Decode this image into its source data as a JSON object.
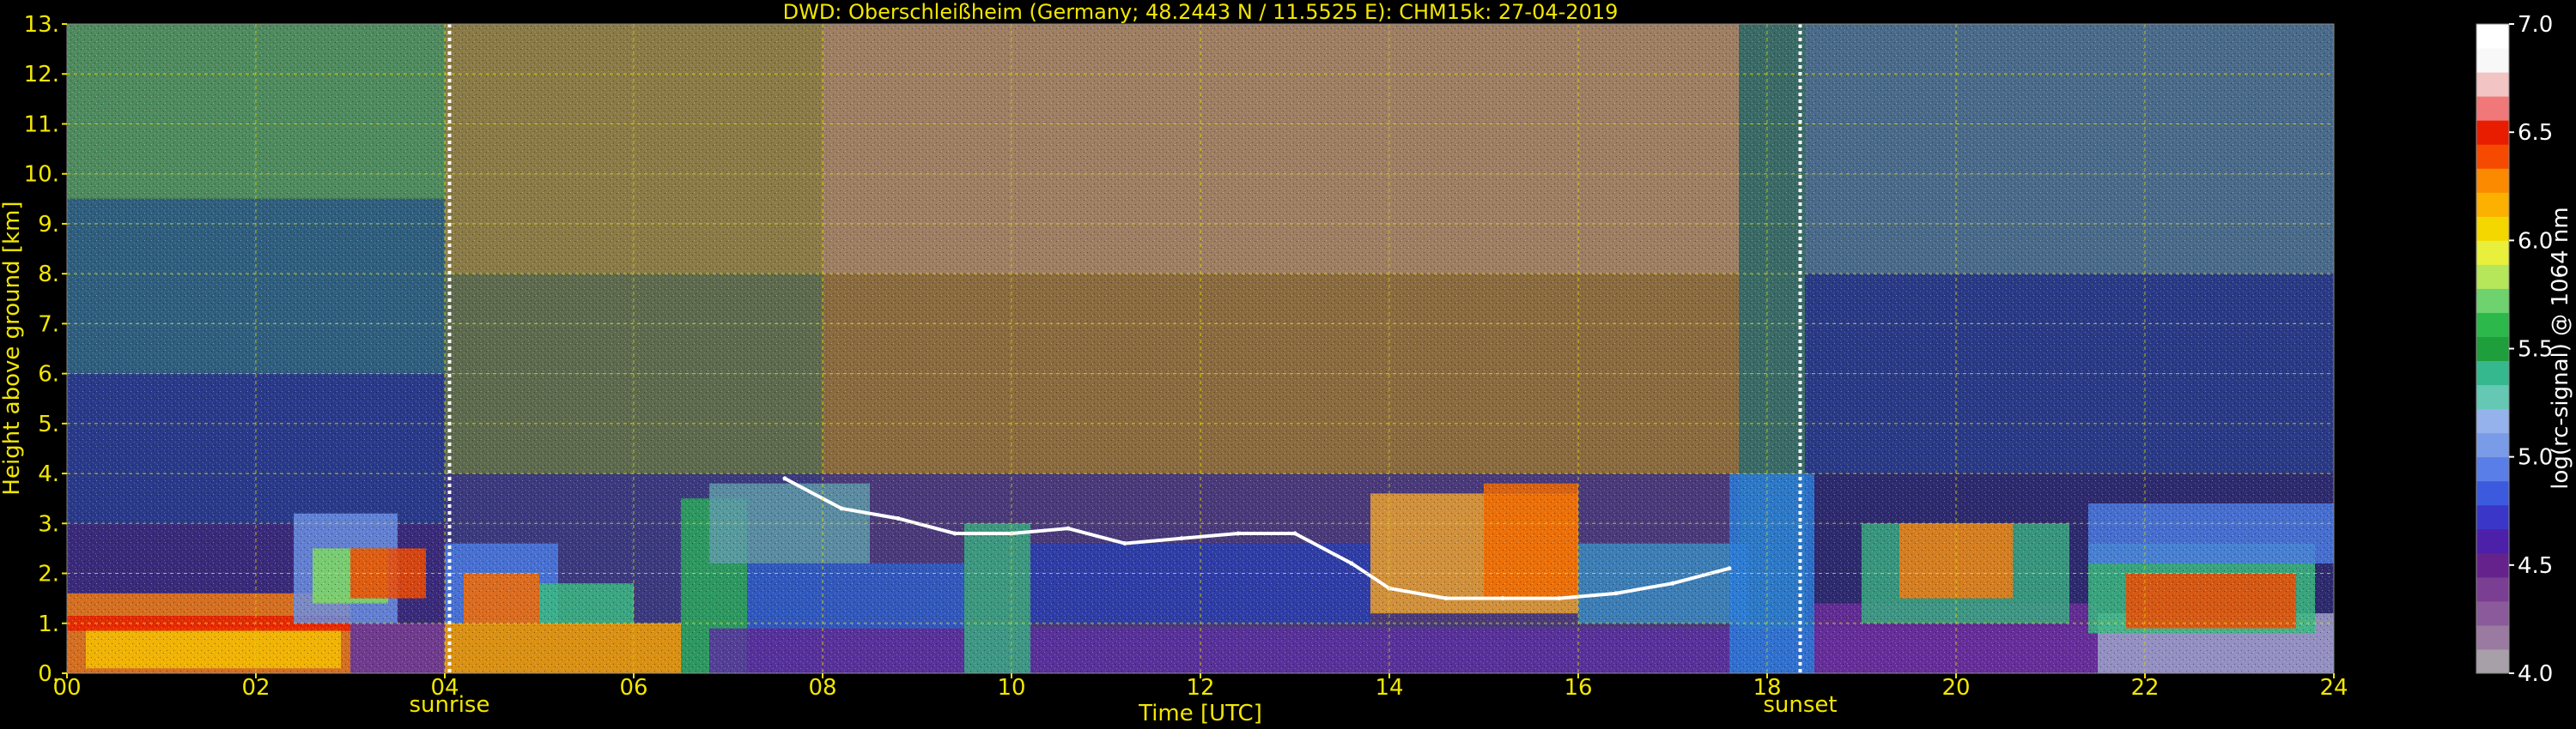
{
  "chart_data": {
    "type": "heatmap",
    "title": "DWD: Oberschleißheim (Germany; 48.2443 N / 11.5525 E):    CHM15k: 27-04-2019",
    "xlabel": "Time [UTC]",
    "ylabel": "Height above ground [km]",
    "colorbar_label": "log(rc-signal) @ 1064 nm",
    "xlim": [
      0,
      24
    ],
    "ylim": [
      0,
      13
    ],
    "color_range": [
      4.0,
      7.0
    ],
    "x_tick_labels": [
      "00",
      "02",
      "04",
      "06",
      "08",
      "10",
      "12",
      "14",
      "16",
      "18",
      "20",
      "22",
      "24"
    ],
    "y_tick_labels": [
      "0.",
      "1.",
      "2.",
      "3.",
      "4.",
      "5.",
      "6.",
      "7.",
      "8.",
      "9.",
      "10.",
      "11.",
      "12.",
      "13."
    ],
    "colorbar_tick_labels": [
      "4.0",
      "4.5",
      "5.0",
      "5.5",
      "6.0",
      "6.5",
      "7.0"
    ],
    "grid": true,
    "events": [
      {
        "name": "sunrise",
        "time": 4.05
      },
      {
        "name": "sunset",
        "time": 18.35
      }
    ],
    "colormap": [
      "#a8a0a8",
      "#9a7aa0",
      "#8a5a9a",
      "#7a3e92",
      "#66228c",
      "#4c20a8",
      "#3a36c8",
      "#3c5ade",
      "#5a7ee8",
      "#7a9ce8",
      "#96b2ec",
      "#64c8b4",
      "#36b88e",
      "#1f9e3c",
      "#2cb84a",
      "#6ed26e",
      "#b6e65a",
      "#e8f03c",
      "#f5d700",
      "#fcb000",
      "#fb8a00",
      "#f64a00",
      "#e81d00",
      "#f07878",
      "#f2c4c4",
      "#f8f8f8",
      "#ffffff"
    ],
    "background_layers": [
      {
        "t0": 0.0,
        "t1": 4.0,
        "h0": 0.0,
        "h1": 3.0,
        "color": "#3a2a7a",
        "value": 4.8
      },
      {
        "t0": 0.0,
        "t1": 4.0,
        "h0": 3.0,
        "h1": 6.0,
        "color": "#2a3a8a",
        "value": 5.0
      },
      {
        "t0": 0.0,
        "t1": 4.0,
        "h0": 6.0,
        "h1": 9.5,
        "color": "#2f5e7e",
        "value": 5.2
      },
      {
        "t0": 0.0,
        "t1": 4.0,
        "h0": 9.5,
        "h1": 13.0,
        "color": "#4e8a5e",
        "value": 5.4
      },
      {
        "t0": 4.0,
        "t1": 8.0,
        "h0": 0.0,
        "h1": 4.0,
        "color": "#3c3a7e",
        "value": 5.0
      },
      {
        "t0": 4.0,
        "t1": 8.0,
        "h0": 4.0,
        "h1": 8.0,
        "color": "#5e6a4e",
        "value": 5.6
      },
      {
        "t0": 4.0,
        "t1": 8.0,
        "h0": 8.0,
        "h1": 13.0,
        "color": "#8a7a46",
        "value": 5.9
      },
      {
        "t0": 8.0,
        "t1": 17.7,
        "h0": 0.0,
        "h1": 4.0,
        "color": "#4a3a7a",
        "value": 5.0
      },
      {
        "t0": 8.0,
        "t1": 17.7,
        "h0": 4.0,
        "h1": 8.0,
        "color": "#8a6a3e",
        "value": 6.0
      },
      {
        "t0": 8.0,
        "t1": 17.7,
        "h0": 8.0,
        "h1": 13.0,
        "color": "#9e7e62",
        "value": 6.3
      },
      {
        "t0": 17.7,
        "t1": 18.4,
        "h0": 0.0,
        "h1": 13.0,
        "color": "#3a6a66",
        "value": 5.5
      },
      {
        "t0": 18.4,
        "t1": 24.0,
        "h0": 0.0,
        "h1": 4.0,
        "color": "#2e2a6e",
        "value": 4.7
      },
      {
        "t0": 18.4,
        "t1": 24.0,
        "h0": 4.0,
        "h1": 8.0,
        "color": "#2a3a86",
        "value": 4.9
      },
      {
        "t0": 18.4,
        "t1": 24.0,
        "h0": 8.0,
        "h1": 13.0,
        "color": "#4a6a8a",
        "value": 5.2
      }
    ],
    "signal_regions": [
      {
        "t0": 0.0,
        "t1": 3.0,
        "h0": 0.0,
        "h1": 1.6,
        "color": "#f07a10",
        "value": 6.2
      },
      {
        "t0": 0.2,
        "t1": 2.9,
        "h0": 0.1,
        "h1": 0.9,
        "color": "#f4c000",
        "value": 6.1
      },
      {
        "t0": 0.0,
        "t1": 3.0,
        "h0": 0.85,
        "h1": 1.15,
        "color": "#e81d00",
        "value": 6.6
      },
      {
        "t0": 2.4,
        "t1": 3.5,
        "h0": 1.0,
        "h1": 3.2,
        "color": "#6a8ee0",
        "value": 5.2
      },
      {
        "t0": 2.6,
        "t1": 3.4,
        "h0": 1.4,
        "h1": 2.5,
        "color": "#7ed860",
        "value": 5.8
      },
      {
        "t0": 3.0,
        "t1": 3.8,
        "h0": 1.5,
        "h1": 2.5,
        "color": "#f04a00",
        "value": 6.4
      },
      {
        "t0": 3.0,
        "t1": 4.0,
        "h0": 0.0,
        "h1": 1.0,
        "color": "#7a3e92",
        "value": 4.7
      },
      {
        "t0": 4.0,
        "t1": 6.5,
        "h0": 0.0,
        "h1": 1.0,
        "color": "#f4a000",
        "value": 6.2
      },
      {
        "t0": 4.0,
        "t1": 5.2,
        "h0": 1.0,
        "h1": 2.6,
        "color": "#4a7ae0",
        "value": 5.1
      },
      {
        "t0": 4.2,
        "t1": 5.0,
        "h0": 1.0,
        "h1": 2.0,
        "color": "#f46a00",
        "value": 6.3
      },
      {
        "t0": 5.0,
        "t1": 6.0,
        "h0": 1.0,
        "h1": 1.8,
        "color": "#3ab880",
        "value": 5.6
      },
      {
        "t0": 6.5,
        "t1": 7.2,
        "h0": 0.0,
        "h1": 3.5,
        "color": "#2aa85a",
        "value": 5.6
      },
      {
        "t0": 6.8,
        "t1": 8.5,
        "h0": 2.2,
        "h1": 3.8,
        "color": "#5e9aa8",
        "value": 5.4
      },
      {
        "t0": 6.8,
        "t1": 24.0,
        "h0": 0.0,
        "h1": 0.9,
        "color": "#5a30a0",
        "value": 4.6
      },
      {
        "t0": 7.2,
        "t1": 9.5,
        "h0": 0.9,
        "h1": 2.2,
        "color": "#2e5ec8",
        "value": 4.9
      },
      {
        "t0": 9.5,
        "t1": 10.2,
        "h0": 0.0,
        "h1": 3.0,
        "color": "#3aa880",
        "value": 5.4
      },
      {
        "t0": 10.2,
        "t1": 13.8,
        "h0": 1.0,
        "h1": 2.6,
        "color": "#2a3eae",
        "value": 4.8
      },
      {
        "t0": 13.8,
        "t1": 16.0,
        "h0": 1.2,
        "h1": 3.6,
        "color": "#e8a030",
        "value": 6.0
      },
      {
        "t0": 15.0,
        "t1": 16.0,
        "h0": 1.5,
        "h1": 3.8,
        "color": "#f06a00",
        "value": 6.4
      },
      {
        "t0": 16.0,
        "t1": 17.8,
        "h0": 1.0,
        "h1": 2.6,
        "color": "#3a8ac0",
        "value": 5.2
      },
      {
        "t0": 17.6,
        "t1": 18.5,
        "h0": 0.0,
        "h1": 4.0,
        "color": "#2a7ad8",
        "value": 5.1
      },
      {
        "t0": 18.5,
        "t1": 21.5,
        "h0": 0.0,
        "h1": 1.4,
        "color": "#6a2e9a",
        "value": 4.6
      },
      {
        "t0": 19.0,
        "t1": 21.2,
        "h0": 1.0,
        "h1": 3.0,
        "color": "#3aa880",
        "value": 5.5
      },
      {
        "t0": 19.4,
        "t1": 20.6,
        "h0": 1.5,
        "h1": 3.0,
        "color": "#f07a10",
        "value": 6.2
      },
      {
        "t0": 21.5,
        "t1": 24.0,
        "h0": 0.0,
        "h1": 1.2,
        "color": "#a0a0c8",
        "value": 4.2
      },
      {
        "t0": 21.4,
        "t1": 23.8,
        "h0": 0.8,
        "h1": 2.6,
        "color": "#3ab880",
        "value": 5.6
      },
      {
        "t0": 21.8,
        "t1": 23.6,
        "h0": 0.9,
        "h1": 2.0,
        "color": "#f04a00",
        "value": 6.5
      },
      {
        "t0": 21.4,
        "t1": 24.0,
        "h0": 2.2,
        "h1": 3.4,
        "color": "#4a7ae0",
        "value": 5.1
      }
    ],
    "cloud_layer": [
      {
        "t": 7.6,
        "h": 3.9
      },
      {
        "t": 8.2,
        "h": 3.3
      },
      {
        "t": 8.8,
        "h": 3.1
      },
      {
        "t": 9.4,
        "h": 2.8
      },
      {
        "t": 10.0,
        "h": 2.8
      },
      {
        "t": 10.6,
        "h": 2.9
      },
      {
        "t": 11.2,
        "h": 2.6
      },
      {
        "t": 11.8,
        "h": 2.7
      },
      {
        "t": 12.4,
        "h": 2.8
      },
      {
        "t": 13.0,
        "h": 2.8
      },
      {
        "t": 13.6,
        "h": 2.2
      },
      {
        "t": 14.0,
        "h": 1.7
      },
      {
        "t": 14.6,
        "h": 1.5
      },
      {
        "t": 15.2,
        "h": 1.5
      },
      {
        "t": 15.8,
        "h": 1.5
      },
      {
        "t": 16.4,
        "h": 1.6
      },
      {
        "t": 17.0,
        "h": 1.8
      },
      {
        "t": 17.6,
        "h": 2.1
      }
    ]
  }
}
